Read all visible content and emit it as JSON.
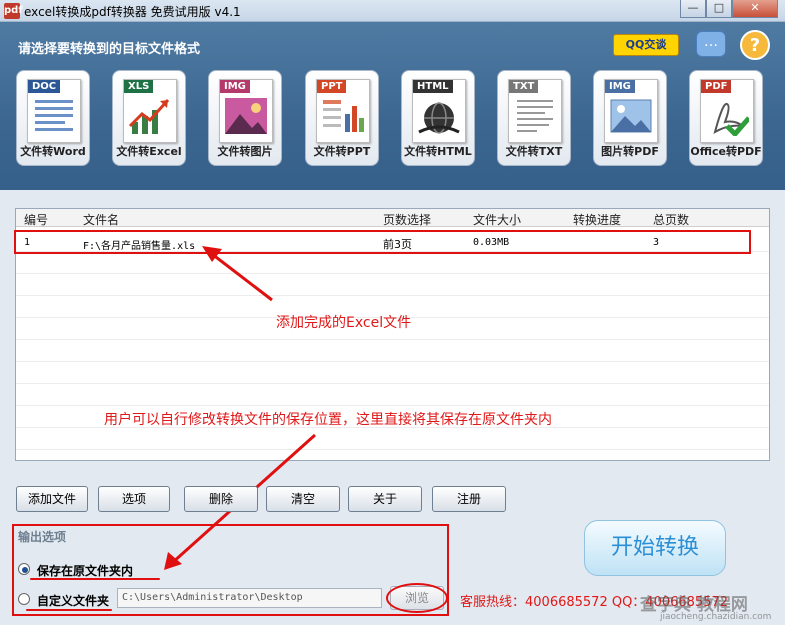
{
  "window": {
    "title": "excel转换成pdf转换器 免费试用版 v4.1",
    "icon_glyph": "pdf",
    "controls": {
      "minimize": "—",
      "maximize": "□",
      "close": "✕"
    }
  },
  "header": {
    "title": "请选择要转换到的目标文件格式",
    "qq_button": "QQ交谈",
    "chat_icon": "chat-bubble-icon",
    "help_icon": "question-mark-icon",
    "help_glyph": "?",
    "chat_glyph": "…"
  },
  "formats": [
    {
      "tag": "DOC",
      "label": "文件转Word",
      "color": "#2b5797"
    },
    {
      "tag": "XLS",
      "label": "文件转Excel",
      "color": "#1e7145"
    },
    {
      "tag": "IMG",
      "label": "文件转图片",
      "color": "#b33a6a"
    },
    {
      "tag": "PPT",
      "label": "文件转PPT",
      "color": "#d24726"
    },
    {
      "tag": "HTML",
      "label": "文件转HTML",
      "color": "#333333"
    },
    {
      "tag": "TXT",
      "label": "文件转TXT",
      "color": "#777777"
    },
    {
      "tag": "IMG",
      "label": "图片转PDF",
      "color": "#4a6fa5"
    },
    {
      "tag": "PDF",
      "label": "Office转PDF",
      "color": "#c0392b"
    }
  ],
  "table": {
    "columns": [
      "编号",
      "文件名",
      "页数选择",
      "文件大小",
      "转换进度",
      "总页数"
    ],
    "rows": [
      {
        "id": "1",
        "filename": "F:\\各月产品销售量.xls",
        "pages": "前3页",
        "size": "0.03MB",
        "progress": "",
        "total": "3"
      }
    ]
  },
  "annotations": {
    "added": "添加完成的Excel文件",
    "save_hint": "用户可以自行修改转换文件的保存位置，这里直接将其保存在原文件夹内"
  },
  "toolbar": {
    "add_file": "添加文件",
    "options": "选项",
    "delete": "删除",
    "clear": "清空",
    "about": "关于",
    "register": "注册"
  },
  "output": {
    "title": "输出选项",
    "option_original": "保存在原文件夹内",
    "option_custom": "自定义文件夹",
    "path": "C:\\Users\\Administrator\\Desktop",
    "browse": "浏览",
    "selected": "original"
  },
  "start_button": "开始转换",
  "hotline": "客服热线：4006685572 QQ：4006685572",
  "watermark": {
    "text": "查字典 教程网",
    "url": "jiaocheng.chazidian.com"
  },
  "colors": {
    "accent_red": "#e01010",
    "header_blue": "#3c6690",
    "start_text": "#2b8fd6"
  }
}
